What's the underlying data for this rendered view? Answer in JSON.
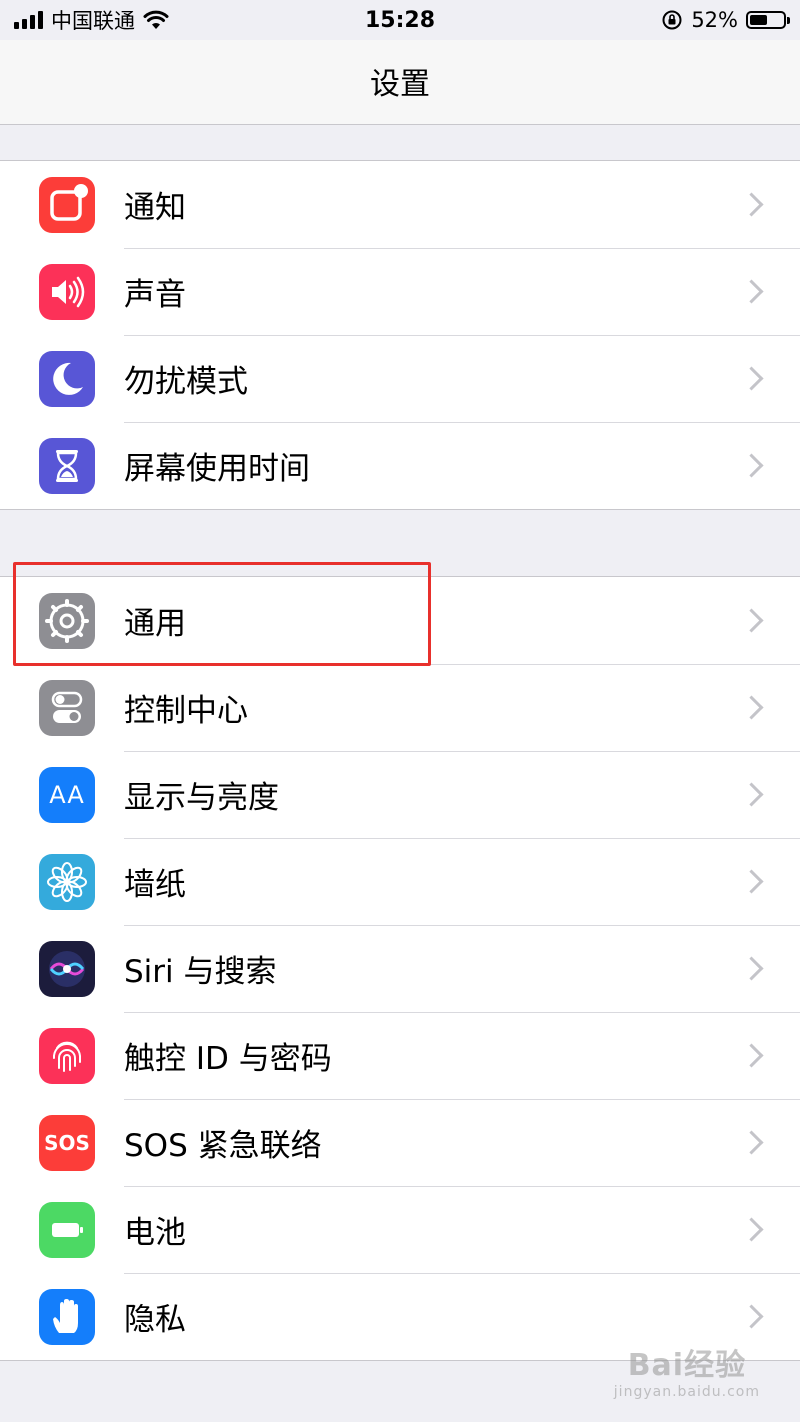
{
  "status_bar": {
    "carrier": "中国联通",
    "time": "15:28",
    "battery_percent": "52%",
    "battery_level": 0.52
  },
  "nav": {
    "title": "设置"
  },
  "groups": [
    {
      "items": [
        {
          "label": "通知",
          "icon": "notifications-icon",
          "color": "#fc3d39"
        },
        {
          "label": "声音",
          "icon": "sounds-icon",
          "color": "#fc3158"
        },
        {
          "label": "勿扰模式",
          "icon": "moon-icon",
          "color": "#5856d6"
        },
        {
          "label": "屏幕使用时间",
          "icon": "hourglass-icon",
          "color": "#5856d6"
        }
      ]
    },
    {
      "items": [
        {
          "label": "通用",
          "icon": "gear-icon",
          "color": "#8e8e93"
        },
        {
          "label": "控制中心",
          "icon": "switches-icon",
          "color": "#8e8e93"
        },
        {
          "label": "显示与亮度",
          "icon": "text-size-icon",
          "color": "#147efb",
          "icon_text": "AA"
        },
        {
          "label": "墙纸",
          "icon": "flower-icon",
          "color": "#34aadc"
        },
        {
          "label": "Siri 与搜索",
          "icon": "siri-icon",
          "color": "#1c1c3c"
        },
        {
          "label": "触控 ID 与密码",
          "icon": "fingerprint-icon",
          "color": "#fc3158"
        },
        {
          "label": "SOS 紧急联络",
          "icon": "sos-icon",
          "color": "#fc3d39",
          "icon_text": "SOS"
        },
        {
          "label": "电池",
          "icon": "battery-icon",
          "color": "#4cd964"
        },
        {
          "label": "隐私",
          "icon": "hand-icon",
          "color": "#147efb"
        }
      ]
    }
  ],
  "watermark": {
    "brand": "Bai经验",
    "url": "jingyan.baidu.com"
  },
  "colors": {
    "highlight": "#e8302c",
    "background": "#efeff4"
  }
}
